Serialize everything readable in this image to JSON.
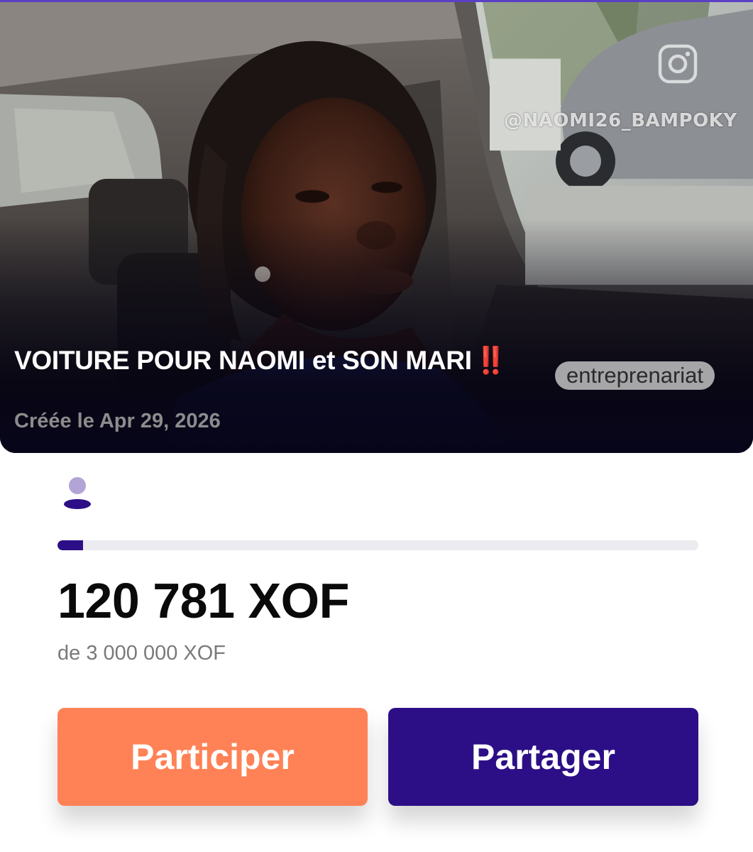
{
  "campaign": {
    "title": "VOITURE POUR NAOMI et SON MARI",
    "title_emoji": "‼️",
    "category": "entreprenariat",
    "created_label": "Créée le Apr 29, 2026",
    "photo_watermark": "@NAOMI26_BAMPOKY",
    "watermark_icon": "instagram-icon"
  },
  "funding": {
    "raised_label": "120 781 XOF",
    "goal_label": "de 3 000 000 XOF",
    "progress_fraction": 0.04
  },
  "actions": {
    "participate_label": "Participer",
    "share_label": "Partager"
  },
  "colors": {
    "brand_purple": "#2c0f86",
    "accent_orange": "#ff8256",
    "avatar_light": "#b3a4d6",
    "track_gray": "#ecebef"
  }
}
